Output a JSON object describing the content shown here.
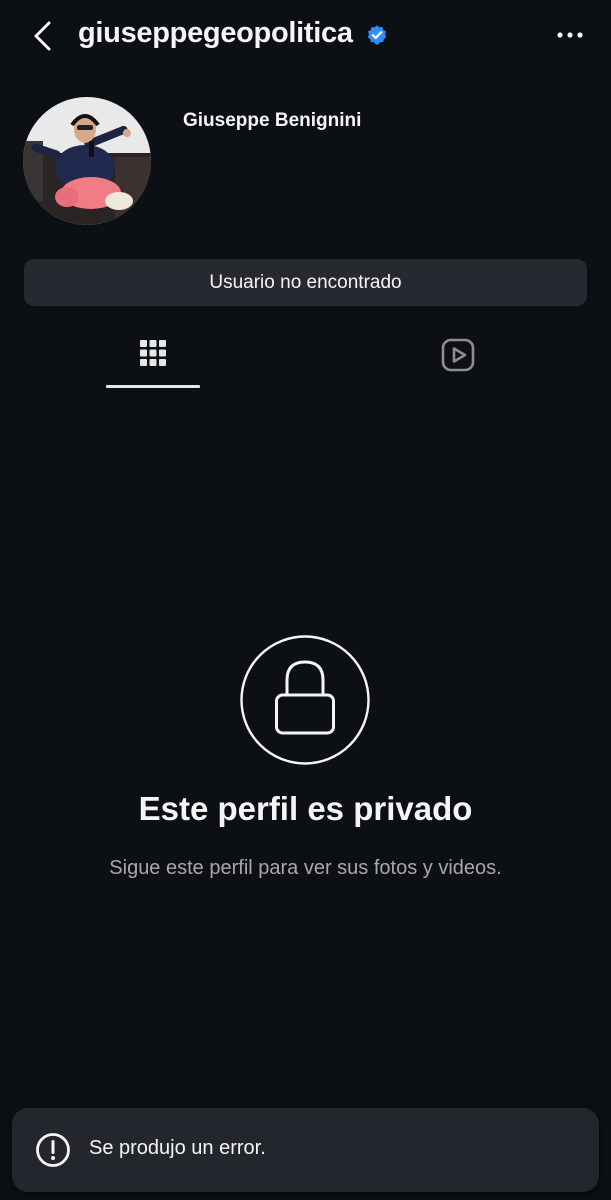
{
  "header": {
    "username": "giuseppegeopolitica",
    "back_icon": "chevron-left-icon",
    "verified_icon": "verified-badge-icon",
    "more_icon": "more-horizontal-icon"
  },
  "profile": {
    "display_name": "Giuseppe Benignini",
    "avatar_icon": "avatar-photo"
  },
  "status_button": {
    "label": "Usuario no encontrado"
  },
  "tabs": [
    {
      "icon": "grid-icon",
      "selected": true
    },
    {
      "icon": "reels-icon",
      "selected": false
    }
  ],
  "private_notice": {
    "icon": "lock-icon",
    "title": "Este perfil es privado",
    "subtitle": "Sigue este perfil para ver sus fotos y videos."
  },
  "toast": {
    "icon": "exclamation-circle-icon",
    "message": "Se produjo un error."
  },
  "colors": {
    "background": "#0c1014",
    "button_background": "#262a30",
    "verified_blue": "#2b8ff5",
    "secondary_text": "#a8a8a8",
    "toast_background": "#23272d"
  }
}
